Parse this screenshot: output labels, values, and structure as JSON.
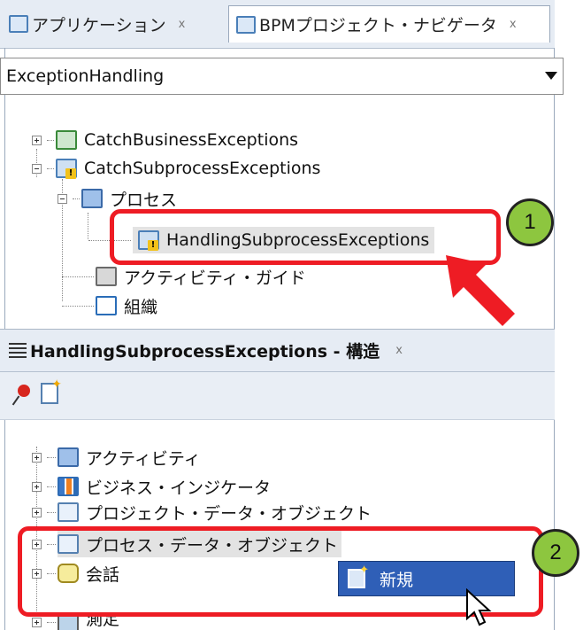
{
  "tabs": [
    {
      "label": "アプリケーション",
      "close": "x"
    },
    {
      "label": "BPMプロジェクト・ナビゲータ",
      "close": "x"
    }
  ],
  "project_select": {
    "value": "ExceptionHandling"
  },
  "nav_tree": [
    {
      "label": "CatchBusinessExceptions",
      "icon": "process-project-icon"
    },
    {
      "label": "CatchSubprocessExceptions",
      "icon": "process-project-warning-icon"
    },
    {
      "label": "プロセス",
      "icon": "processes-folder-icon"
    },
    {
      "label": "HandlingSubprocessExceptions",
      "icon": "process-warning-icon"
    },
    {
      "label": "アクティビティ・ガイド",
      "icon": "activity-guide-icon"
    },
    {
      "label": "組織",
      "icon": "organization-icon"
    }
  ],
  "structure_panel": {
    "title": "HandlingSubprocessExceptions - 構造",
    "close": "x",
    "items": [
      {
        "label": "アクティビティ",
        "icon": "activities-icon"
      },
      {
        "label": "ビジネス・インジケータ",
        "icon": "business-indicators-icon"
      },
      {
        "label": "プロジェクト・データ・オブジェクト",
        "icon": "project-data-object-icon"
      },
      {
        "label": "プロセス・データ・オブジェクト",
        "icon": "process-data-object-icon"
      },
      {
        "label": "会話",
        "icon": "conversation-icon"
      },
      {
        "label": "測定",
        "icon": "measurement-icon"
      }
    ]
  },
  "context_menu": {
    "new_label": "新規"
  },
  "annotations": {
    "badge1": "1",
    "badge2": "2"
  },
  "colors": {
    "highlight": "#ee1c24",
    "badge": "#8dc63f",
    "menu_selected": "#2f5fb7"
  }
}
